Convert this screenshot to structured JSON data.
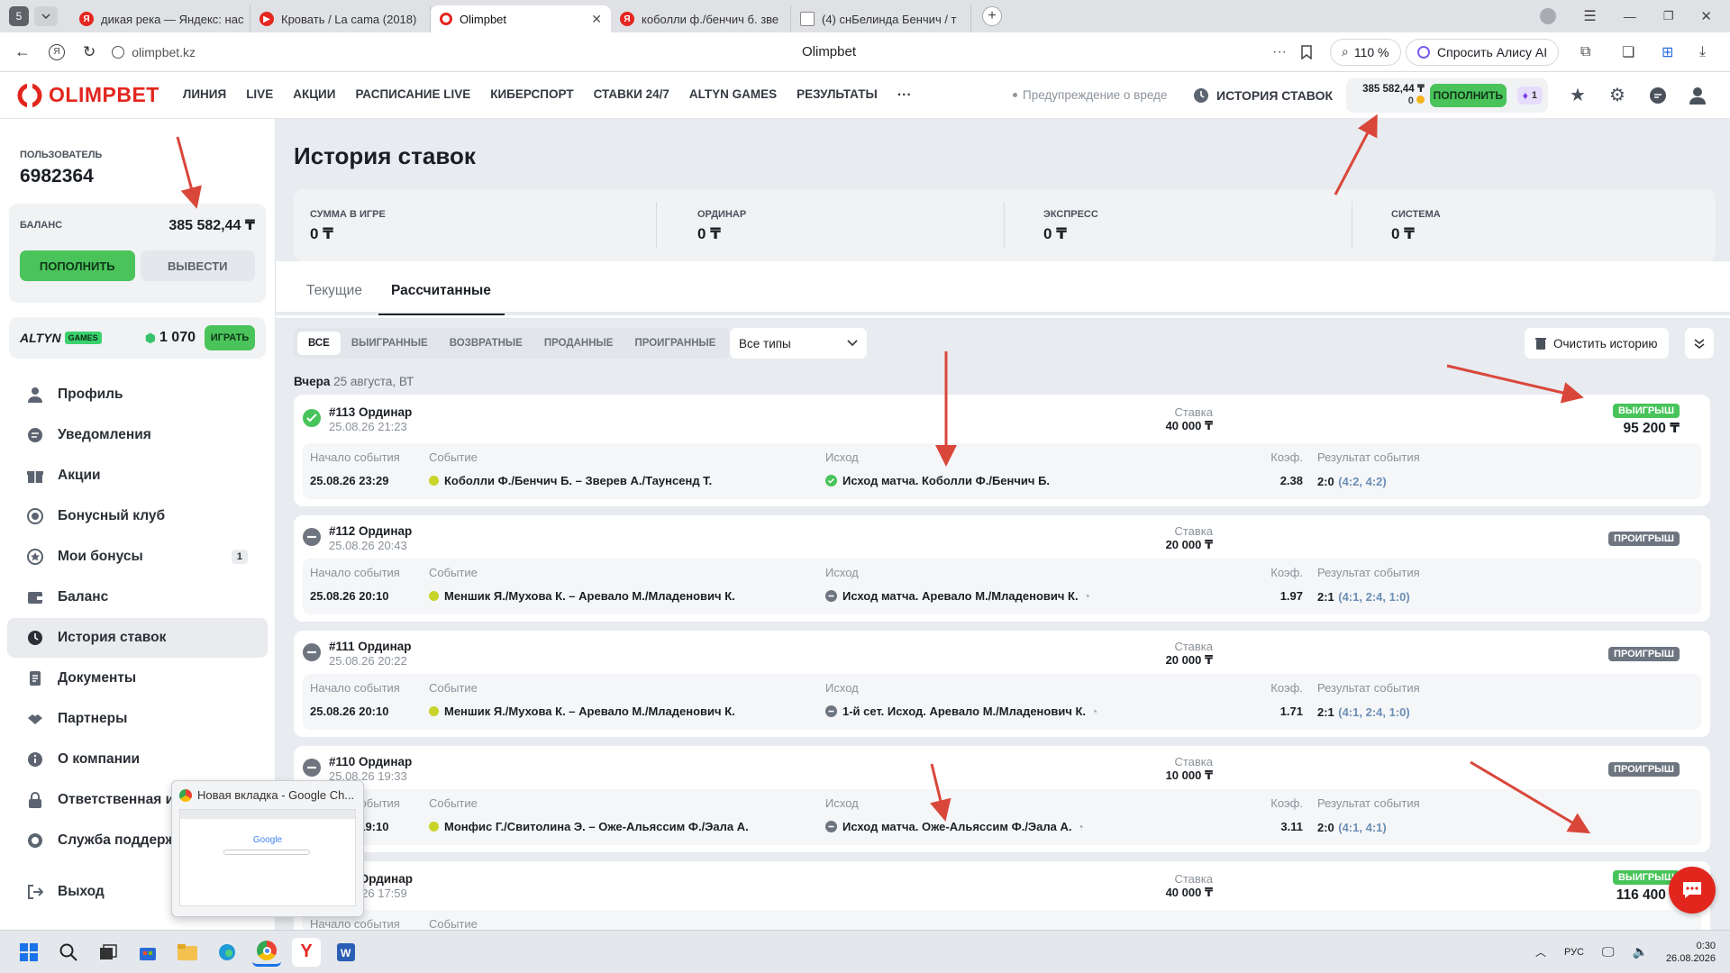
{
  "browser": {
    "tabs": [
      {
        "label": "дикая река — Яндекс: нас",
        "icon": "yandex-icon"
      },
      {
        "label": "Кровать / La cama (2018)",
        "icon": "video-icon"
      },
      {
        "label": "Olimpbet",
        "icon": "olimpbet-icon"
      },
      {
        "label": "коболли ф./бенчич б. зве",
        "icon": "yandex-icon"
      },
      {
        "label": "(4) снБелинда Бенчич / т",
        "icon": "page-icon"
      }
    ],
    "tab_counter": "5",
    "address": "olimpbet.kz",
    "page_title": "Olimpbet",
    "zoom": "110 %",
    "alice": "Спросить Алису AI"
  },
  "header": {
    "logo": "OLIMPBET",
    "nav": [
      "ЛИНИЯ",
      "LIVE",
      "АКЦИИ",
      "РАСПИСАНИЕ LIVE",
      "КИБЕРСПОРТ",
      "СТАВКИ 24/7",
      "ALTYN GAMES",
      "РЕЗУЛЬТАТЫ"
    ],
    "more": "···",
    "warning": "Предупреждение о вреде",
    "history": "ИСТОРИЯ СТАВОК",
    "balance": "385 582,44 ₸",
    "bonus": "0",
    "deposit": "ПОПОЛНИТЬ",
    "badge_count": "1"
  },
  "sidebar": {
    "user_label": "ПОЛЬЗОВАТЕЛЬ",
    "user_id": "6982364",
    "balance_label": "БАЛАНС",
    "balance": "385 582,44 ₸",
    "deposit": "ПОПОЛНИТЬ",
    "withdraw": "ВЫВЕСТИ",
    "altyn_logo": "ALTYN",
    "altyn_games": "GAMES",
    "altyn_points": "1 070",
    "altyn_play": "ИГРАТЬ",
    "items": [
      {
        "label": "Профиль",
        "icon": "user-icon"
      },
      {
        "label": "Уведомления",
        "icon": "bell-icon"
      },
      {
        "label": "Акции",
        "icon": "gift-icon"
      },
      {
        "label": "Бонусный клуб",
        "icon": "club-icon"
      },
      {
        "label": "Мои бонусы",
        "icon": "star-icon",
        "badge": "1"
      },
      {
        "label": "Баланс",
        "icon": "wallet-icon"
      },
      {
        "label": "История ставок",
        "icon": "clock-icon",
        "active": true
      },
      {
        "label": "Документы",
        "icon": "document-icon"
      },
      {
        "label": "Партнеры",
        "icon": "handshake-icon"
      },
      {
        "label": "О компании",
        "icon": "info-icon"
      },
      {
        "label": "Ответственная иг",
        "icon": "lock-icon"
      },
      {
        "label": "Служба поддерж",
        "icon": "support-icon"
      }
    ],
    "logout": "Выход"
  },
  "main": {
    "title": "История ставок",
    "summary": [
      {
        "label": "СУММА В ИГРЕ",
        "value": "0 ₸"
      },
      {
        "label": "ОРДИНАР",
        "value": "0 ₸"
      },
      {
        "label": "ЭКСПРЕСС",
        "value": "0 ₸"
      },
      {
        "label": "СИСТЕМА",
        "value": "0 ₸"
      }
    ],
    "tabs": [
      "Текущие",
      "Рассчитанные"
    ],
    "filters": [
      "ВСЕ",
      "ВЫИГРАННЫЕ",
      "ВОЗВРАТНЫЕ",
      "ПРОДАННЫЕ",
      "ПРОИГРАННЫЕ"
    ],
    "type_select": "Все типы",
    "clear_history": "Очистить историю",
    "day_label": "Вчера",
    "day_date": "25 августа, ВТ",
    "col": {
      "start": "Начало события",
      "event": "Событие",
      "outcome": "Исход",
      "coef": "Коэф.",
      "result": "Результат события",
      "stake": "Ставка"
    },
    "bets": [
      {
        "id": "#113 Ординар",
        "time": "25.08.26 21:23",
        "stake": "40 000 ₸",
        "status": "ВЫИГРЫШ",
        "win": "95 200 ₸",
        "start": "25.08.26 23:29",
        "event": "Коболли Ф./Бенчич Б. – Зверев А./Таунсенд Т.",
        "outcome": "Исход матча. Коболли Ф./Бенчич Б.",
        "coef": "2.38",
        "score": "2:0",
        "score_detail": "(4:2, 4:2)"
      },
      {
        "id": "#112 Ординар",
        "time": "25.08.26 20:43",
        "stake": "20 000 ₸",
        "status": "ПРОИГРЫШ",
        "win": "",
        "start": "25.08.26 20:10",
        "event": "Меншик Я./Мухова К. – Аревало М./Младенович К.",
        "outcome": "Исход матча. Аревало М./Младенович К.",
        "coef": "1.97",
        "score": "2:1",
        "score_detail": "(4:1, 2:4, 1:0)"
      },
      {
        "id": "#111 Ординар",
        "time": "25.08.26 20:22",
        "stake": "20 000 ₸",
        "status": "ПРОИГРЫШ",
        "win": "",
        "start": "25.08.26 20:10",
        "event": "Меншик Я./Мухова К. – Аревало М./Младенович К.",
        "outcome": "1-й сет. Исход. Аревало М./Младенович К.",
        "coef": "1.71",
        "score": "2:1",
        "score_detail": "(4:1, 2:4, 1:0)"
      },
      {
        "id": "#110 Ординар",
        "time": "25.08.26 19:33",
        "stake": "10 000 ₸",
        "status": "ПРОИГРЫШ",
        "win": "",
        "start": "25.08.26 19:10",
        "event": "Монфис Г./Свитолина Э. – Оже-Альяссим Ф./Эала А.",
        "outcome": "Исход матча. Оже-Альяссим Ф./Эала А.",
        "coef": "3.11",
        "score": "2:0",
        "score_detail": "(4:1, 4:1)"
      },
      {
        "id": "#109 Ординар",
        "time": "25.08.26 17:59",
        "stake": "40 000 ₸",
        "status": "ВЫИГРЫШ",
        "win": "116 400 ₸",
        "start": "",
        "event": "",
        "outcome": "",
        "coef": "",
        "score": "",
        "score_detail": ""
      }
    ]
  },
  "preview": {
    "title": "Новая вкладка - Google Ch...",
    "logo": "Google"
  },
  "taskbar": {
    "lang": "РУС",
    "time": "0:30",
    "date": "26.08.2026"
  },
  "colors": {
    "brand_red": "#e2261e",
    "green": "#4ac45a",
    "annotation": "#d9473b"
  }
}
